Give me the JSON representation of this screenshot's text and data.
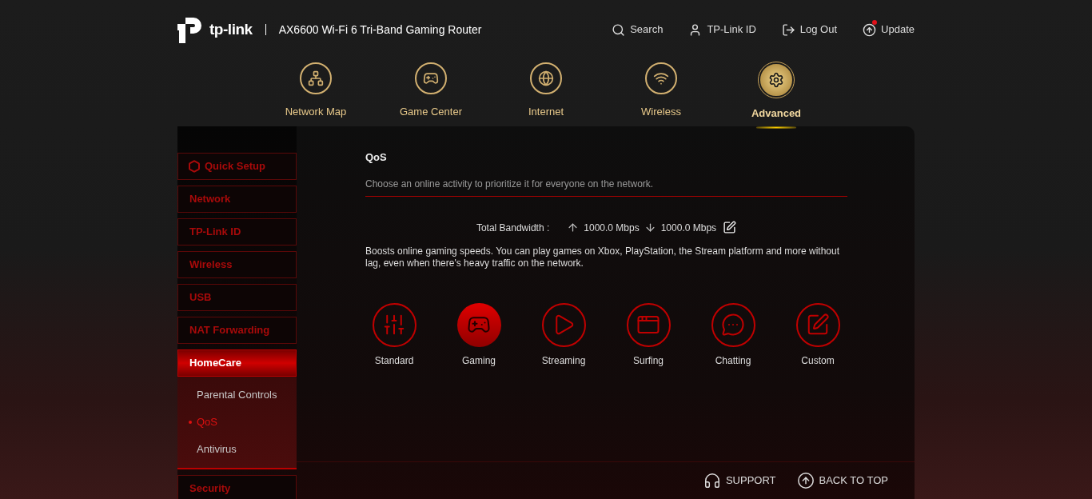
{
  "header": {
    "logo_text": "tp-link",
    "product": "AX6600 Wi-Fi 6 Tri-Band Gaming Router",
    "links": [
      {
        "kind": "search",
        "label": "Search",
        "badge": false
      },
      {
        "kind": "account",
        "label": "TP-Link ID",
        "badge": false
      },
      {
        "kind": "logout",
        "label": "Log Out",
        "badge": false
      },
      {
        "kind": "update",
        "label": "Update",
        "badge": true
      }
    ]
  },
  "nav": [
    {
      "kind": "map",
      "label": "Network Map",
      "selected": false
    },
    {
      "kind": "game",
      "label": "Game Center",
      "selected": false
    },
    {
      "kind": "internet",
      "label": "Internet",
      "selected": false
    },
    {
      "kind": "wireless",
      "label": "Wireless",
      "selected": false
    },
    {
      "kind": "advanced",
      "label": "Advanced",
      "selected": true
    }
  ],
  "sidebar": {
    "items": [
      {
        "label": "Quick Setup",
        "icon": true,
        "selected": false
      },
      {
        "label": "Network",
        "icon": false,
        "selected": false
      },
      {
        "label": "TP-Link ID",
        "icon": false,
        "selected": false
      },
      {
        "label": "Wireless",
        "icon": false,
        "selected": false
      },
      {
        "label": "USB",
        "icon": false,
        "selected": false
      },
      {
        "label": "NAT Forwarding",
        "icon": false,
        "selected": false
      },
      {
        "label": "HomeCare",
        "icon": false,
        "selected": true,
        "children": [
          {
            "label": "Parental Controls",
            "selected": false
          },
          {
            "label": "QoS",
            "selected": true
          },
          {
            "label": "Antivirus",
            "selected": false
          }
        ]
      },
      {
        "label": "Security",
        "icon": false,
        "selected": false
      }
    ]
  },
  "content": {
    "title": "QoS",
    "subtitle": "Choose an online activity to prioritize it for everyone on the network.",
    "bandwidth": {
      "label": "Total Bandwidth :",
      "upload": "1000.0 Mbps",
      "download": "1000.0 Mbps"
    },
    "description": "Boosts online gaming speeds. You can play games on Xbox, PlayStation, the Stream platform and more without lag, even when there's heavy traffic on the network.",
    "modes": [
      {
        "kind": "standard",
        "label": "Standard",
        "selected": false
      },
      {
        "kind": "gaming",
        "label": "Gaming",
        "selected": true
      },
      {
        "kind": "streaming",
        "label": "Streaming",
        "selected": false
      },
      {
        "kind": "surfing",
        "label": "Surfing",
        "selected": false
      },
      {
        "kind": "chatting",
        "label": "Chatting",
        "selected": false
      },
      {
        "kind": "custom",
        "label": "Custom",
        "selected": false
      }
    ]
  },
  "footer": {
    "support": "SUPPORT",
    "back_to_top": "BACK TO TOP"
  }
}
